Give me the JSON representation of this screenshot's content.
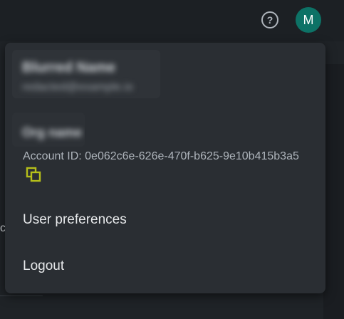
{
  "header": {
    "help_icon_glyph": "?",
    "avatar_initial": "M",
    "avatar_color": "#0d7266"
  },
  "background": {
    "partial_char": "c"
  },
  "user_menu": {
    "profile": {
      "name_blurred": "Blurred Name",
      "email_blurred": "redacted@example.io"
    },
    "organization": {
      "name_blurred": "Org name"
    },
    "account_id_label": "Account ID: ",
    "account_id_value": "0e062c6e-626e-470f-b625-9e10b415b3a5",
    "copy_icon": "copy-icon",
    "copy_icon_color": "#b5bf1a",
    "items": [
      {
        "label": "User preferences"
      },
      {
        "label": "Logout"
      }
    ]
  }
}
